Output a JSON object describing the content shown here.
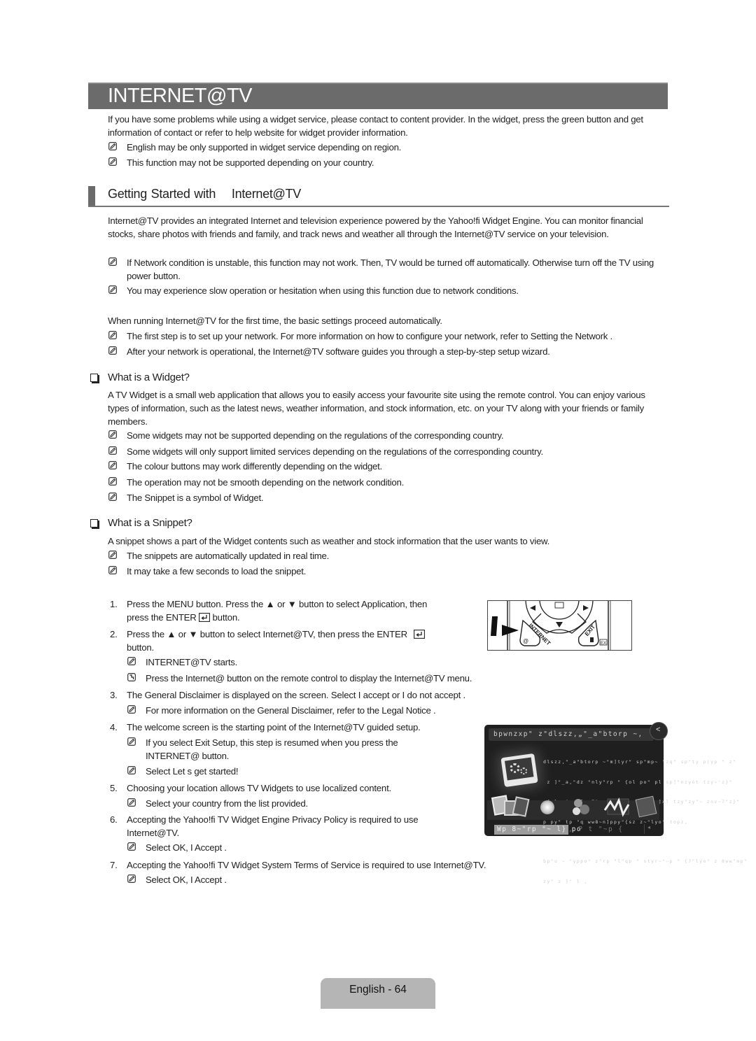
{
  "page": {
    "title": "INTERNET@TV",
    "intro": "If you have some problems while using a widget service, please contact to content provider. In the widget, press the green button and get information of contact or refer to help website for widget provider information.",
    "intro_notes": [
      "English may be only supported in widget service depending on region.",
      "This function may not be supported depending on your country."
    ]
  },
  "getting_started": {
    "heading_a": "Getting Started with",
    "heading_b": "Internet@TV",
    "body": "Internet@TV provides an integrated Internet and television experience powered by the Yahoo!fi Widget Engine. You can monitor financial stocks, share photos with friends and family, and track news and weather all through the Internet@TV service on your television.",
    "notes": [
      "If Network condition is unstable, this function may not work. Then, TV would be turned off automatically. Otherwise turn off the TV using power button.",
      "You may experience slow operation or hesitation when using this function due to network conditions."
    ],
    "first_run": "When running Internet@TV for the first time, the basic settings proceed automatically.",
    "first_run_notes": [
      "The first step is to set up your network. For more information on how to configure your network, refer to  Setting the Network .",
      "After your network is operational, the Internet@TV software guides you through a step-by-step setup wizard."
    ]
  },
  "widget": {
    "heading": "What is a Widget?",
    "body": "A TV Widget is a small web application that allows you to easily access your favourite site using the remote control. You can enjoy various types of information, such as the latest news, weather information, and stock information, etc. on your TV along with your friends or family members.",
    "notes": [
      "Some widgets may not be supported depending on the regulations of the corresponding country.",
      "Some widgets will only support limited services depending on the regulations of the corresponding country.",
      "The colour buttons may work differently depending on the widget.",
      "The operation may not be smooth depending on the network condition.",
      "The Snippet is a symbol of Widget."
    ]
  },
  "snippet": {
    "heading": "What is a Snippet?",
    "body": "A snippet shows a part of the Widget contents such as weather and stock information that the user wants to view.",
    "notes": [
      "The snippets are automatically updated in real time.",
      "It may take a few seconds to load the snippet."
    ]
  },
  "steps": [
    {
      "num": "1.",
      "line1": "Press the MENU button. Press the ▲ or ▼ button to select Application, then",
      "line2": "press the ENTER",
      "line2_tail": "button."
    },
    {
      "num": "2.",
      "line1": "Press the ▲ or ▼ button to select Internet@TV, then press the ENTER",
      "line2": "button.",
      "notes": [
        "INTERNET@TV starts."
      ],
      "tip": "Press the Internet@ button on the remote control to display the  Internet@TV menu."
    },
    {
      "num": "3.",
      "text": "The General Disclaimer is displayed on the screen. Select   I accept or I do not accept   .",
      "notes": [
        "For more information on the General Disclaimer, refer to the    Legal Notice ."
      ]
    },
    {
      "num": "4.",
      "text": "The  welcome screen  is the starting point of the Internet@TV guided setup.",
      "notes": [
        "If you select Exit Setup, this step is resumed when you press the",
        "INTERNET@ button.",
        "Select Let s get started!"
      ]
    },
    {
      "num": "5.",
      "text": "Choosing your location allows TV Widgets to use localized content.",
      "notes": [
        "Select your country from the list provided."
      ]
    },
    {
      "num": "6.",
      "line1": "Accepting the Yahoo!fi TV Widget Engine Privacy Policy is required to use",
      "line2": "Internet@TV.",
      "notes": [
        "Select OK, I Accept ."
      ]
    },
    {
      "num": "7.",
      "text": "Accepting the Yahoo!fi TV Widget System Terms of Service is required to use Internet@TV.",
      "notes": [
        "Select OK, I Accept ."
      ]
    }
  ],
  "remote": {
    "internet_label": "INTERNET",
    "at_label": "@",
    "exit_label": "EXIT",
    "ex_label": "EX"
  },
  "tv_screen": {
    "title": "bpwnzxp\" z\"dlszz,„\"_a\"btorp ~,",
    "back_label": "<",
    "text_lines": [
      "dlszz,\"_a\"btorp ~\"m]tyr\" sp\"mp~ \"zq\" sp\"ty p|yp \" z\"",
      " z ]\"_a,\"dz \"nly\"rp \" {ol po\" pl sp]\"nzyot tzy~'z}\"",
      "~{z} ~\"~nz]p~7\"rp \" {ol po\"tyqz]xl tzy\"zy\"~ znv~7\"z}\"",
      "p py\" tp \"q ww8~n]ppy\"{sz z~\"lyo\" topz,"
    ],
    "text_lines_2": [
      "bp\"u ~ \"yppo\" z\"rp \"l\"qp \" styr~\"~p \" {7\"lyo\" z 8ww\"mp\"",
      "zy\" z ]\" l ,"
    ],
    "button_selected": "Wp 8~\"rp \"~ l} po",
    "button_other": ", P t \"~p {",
    "nav_label": "◂"
  },
  "footer": {
    "page_label": "English - 64"
  }
}
